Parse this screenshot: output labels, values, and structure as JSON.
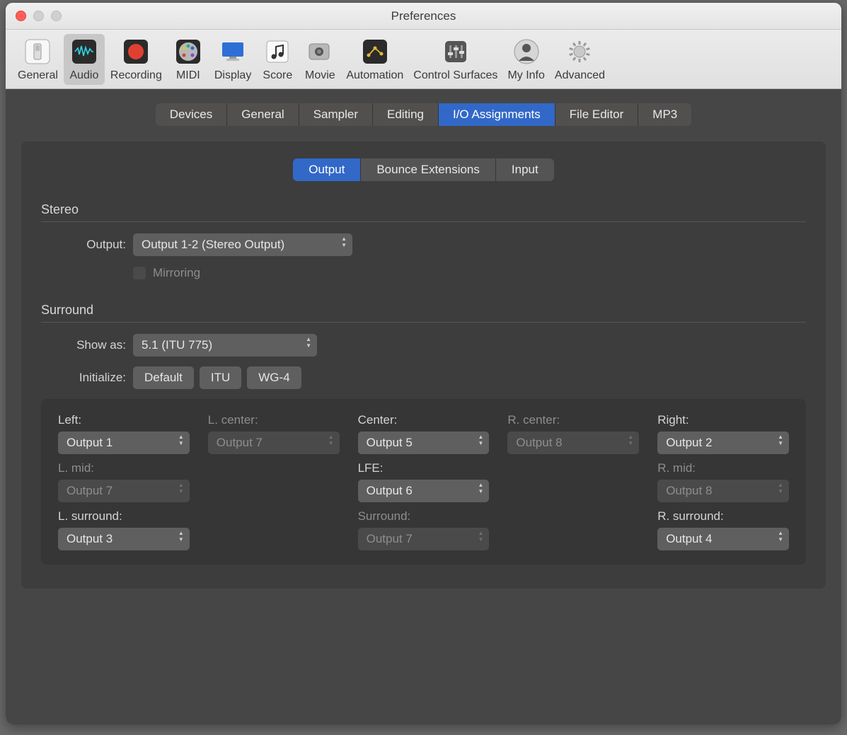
{
  "window": {
    "title": "Preferences"
  },
  "toolbar": {
    "items": [
      {
        "label": "General"
      },
      {
        "label": "Audio"
      },
      {
        "label": "Recording"
      },
      {
        "label": "MIDI"
      },
      {
        "label": "Display"
      },
      {
        "label": "Score"
      },
      {
        "label": "Movie"
      },
      {
        "label": "Automation"
      },
      {
        "label": "Control Surfaces"
      },
      {
        "label": "My Info"
      },
      {
        "label": "Advanced"
      }
    ],
    "selected": 1
  },
  "tabs1": {
    "items": [
      "Devices",
      "General",
      "Sampler",
      "Editing",
      "I/O Assignments",
      "File Editor",
      "MP3"
    ],
    "selected": 4
  },
  "tabs2": {
    "items": [
      "Output",
      "Bounce Extensions",
      "Input"
    ],
    "selected": 0
  },
  "stereo": {
    "heading": "Stereo",
    "output_label": "Output:",
    "output_value": "Output 1-2 (Stereo Output)",
    "mirroring_label": "Mirroring"
  },
  "surround": {
    "heading": "Surround",
    "showas_label": "Show as:",
    "showas_value": "5.1 (ITU 775)",
    "init_label": "Initialize:",
    "init_buttons": [
      "Default",
      "ITU",
      "WG-4"
    ],
    "channels": [
      {
        "label": "Left:",
        "value": "Output 1",
        "disabled": false
      },
      {
        "label": "L. center:",
        "value": "Output 7",
        "disabled": true
      },
      {
        "label": "Center:",
        "value": "Output 5",
        "disabled": false
      },
      {
        "label": "R. center:",
        "value": "Output 8",
        "disabled": true
      },
      {
        "label": "Right:",
        "value": "Output 2",
        "disabled": false
      },
      {
        "label": "L. mid:",
        "value": "Output 7",
        "disabled": true
      },
      {
        "label": "",
        "value": "",
        "disabled": true,
        "empty": true
      },
      {
        "label": "LFE:",
        "value": "Output 6",
        "disabled": false
      },
      {
        "label": "",
        "value": "",
        "disabled": true,
        "empty": true
      },
      {
        "label": "R. mid:",
        "value": "Output 8",
        "disabled": true
      },
      {
        "label": "L. surround:",
        "value": "Output 3",
        "disabled": false
      },
      {
        "label": "",
        "value": "",
        "disabled": true,
        "empty": true
      },
      {
        "label": "Surround:",
        "value": "Output 7",
        "disabled": true
      },
      {
        "label": "",
        "value": "",
        "disabled": true,
        "empty": true
      },
      {
        "label": "R. surround:",
        "value": "Output 4",
        "disabled": false
      }
    ]
  }
}
